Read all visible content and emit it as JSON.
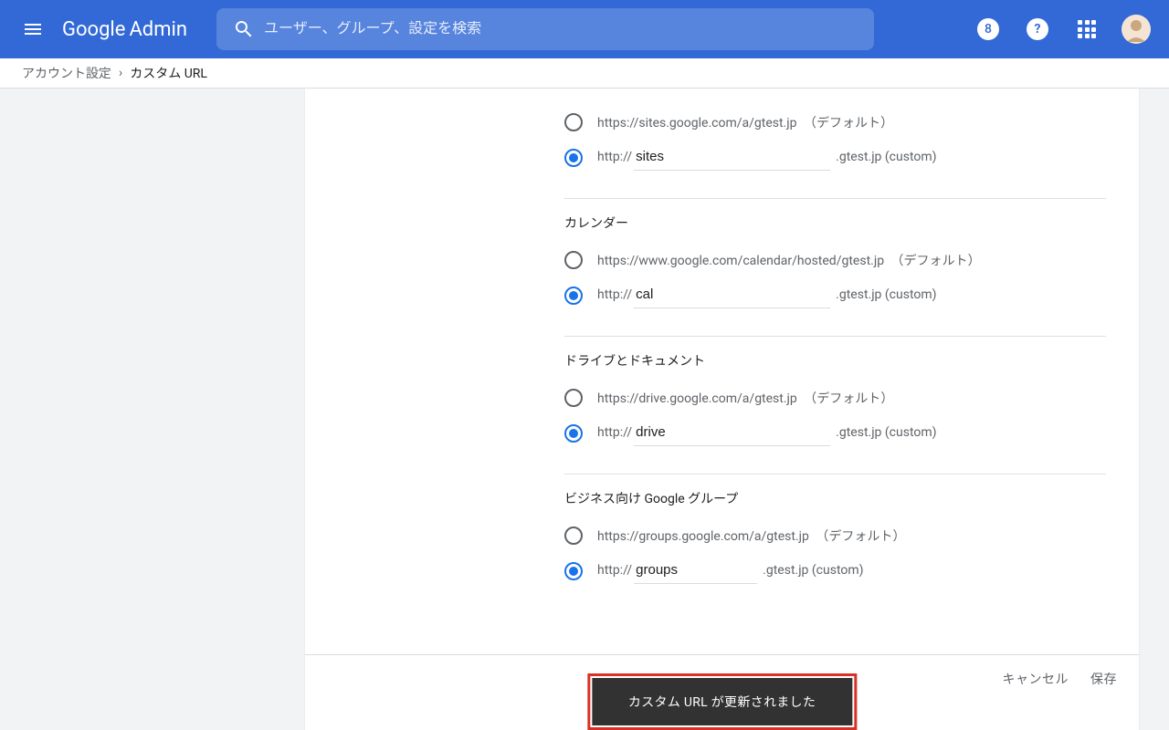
{
  "header": {
    "logo_google": "Google",
    "logo_admin": "Admin",
    "search_placeholder": "ユーザー、グループ、設定を検索",
    "account_icon_char": "8"
  },
  "breadcrumb": {
    "parent": "アカウント設定",
    "current": "カスタム URL"
  },
  "common": {
    "default_suffix": "（デフォルト）",
    "http_prefix": "http:// ",
    "domain_suffix": ".gtest.jp (custom)"
  },
  "sections": [
    {
      "title": "",
      "default_url": "https://sites.google.com/a/gtest.jp",
      "custom_value": "sites",
      "selected": "custom"
    },
    {
      "title": "カレンダー",
      "default_url": "https://www.google.com/calendar/hosted/gtest.jp",
      "custom_value": "cal",
      "selected": "custom"
    },
    {
      "title": "ドライブとドキュメント",
      "default_url": "https://drive.google.com/a/gtest.jp",
      "custom_value": "drive",
      "selected": "custom"
    },
    {
      "title": "ビジネス向け Google グループ",
      "default_url": "https://groups.google.com/a/gtest.jp",
      "custom_value": "groups",
      "selected": "custom"
    }
  ],
  "footer": {
    "cancel": "キャンセル",
    "save": "保存"
  },
  "toast": {
    "message": "カスタム URL が更新されました"
  }
}
